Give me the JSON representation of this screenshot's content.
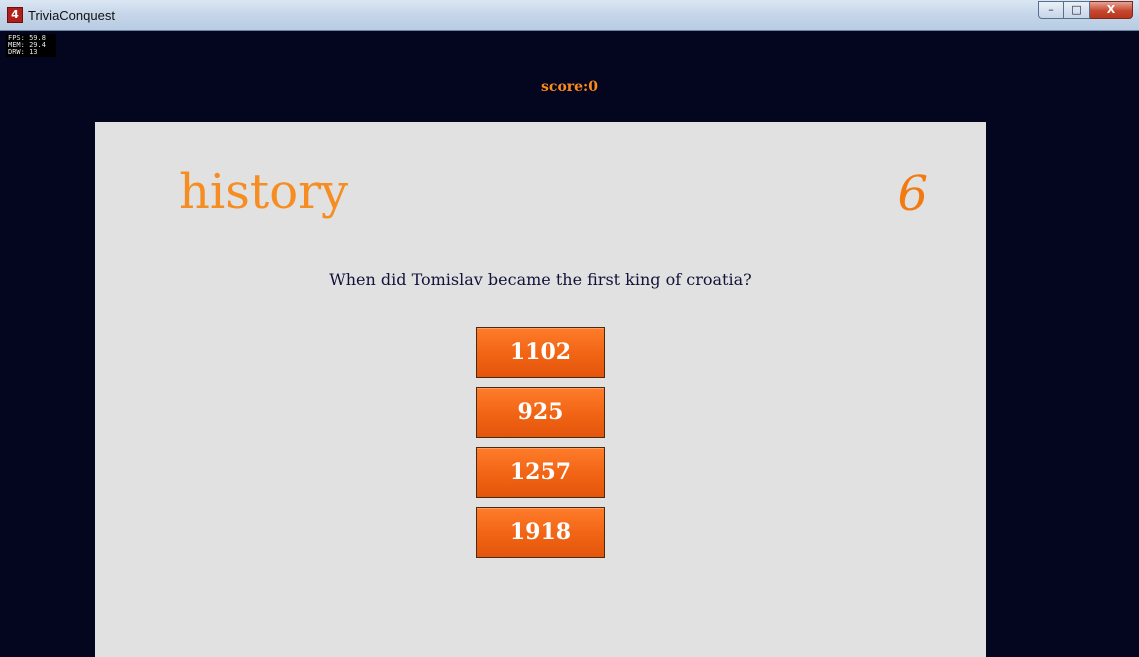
{
  "window": {
    "title": "TriviaConquest",
    "app_icon": "4",
    "controls": {
      "minimize": "–",
      "maximize": "□",
      "close": "X"
    }
  },
  "debug": {
    "fps": "FPS: 59.8",
    "mem": "MEM: 29.4",
    "drw": "DRW: 13"
  },
  "score": {
    "text": "score:0"
  },
  "card": {
    "category": "history",
    "question_counter": "6",
    "question": "When did Tomislav became the first king of croatia?",
    "answers": [
      "1102",
      "925",
      "1257",
      "1918"
    ]
  },
  "colors": {
    "background": "#03061e",
    "card": "#e1e1e1",
    "accent_orange": "#f58d22",
    "button_orange": "#f06414",
    "question_text": "#12123a"
  }
}
